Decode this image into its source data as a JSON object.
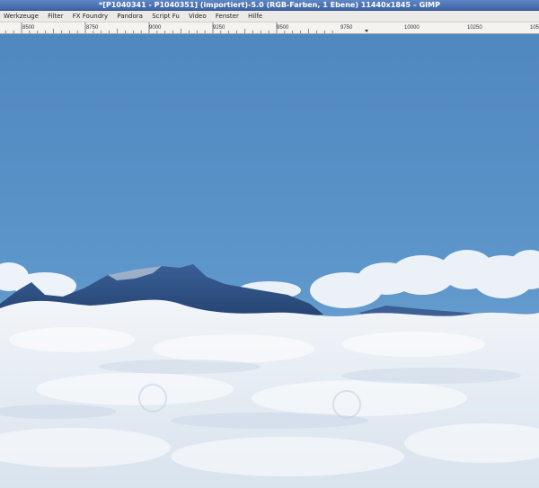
{
  "window": {
    "title": "*[P1040341 - P1040351] (importiert)-5.0 (RGB-Farben, 1 Ebene) 11440x1845 – GIMP"
  },
  "menu": {
    "items": [
      "Werkzeuge",
      "Filter",
      "FX Foundry",
      "Pandora",
      "Script Fu",
      "Video",
      "Fenster",
      "Hilfe"
    ]
  },
  "ruler": {
    "labels": [
      "8500",
      "8750",
      "9000",
      "9250",
      "9500",
      "9750",
      "10000",
      "10250",
      "10500"
    ]
  }
}
